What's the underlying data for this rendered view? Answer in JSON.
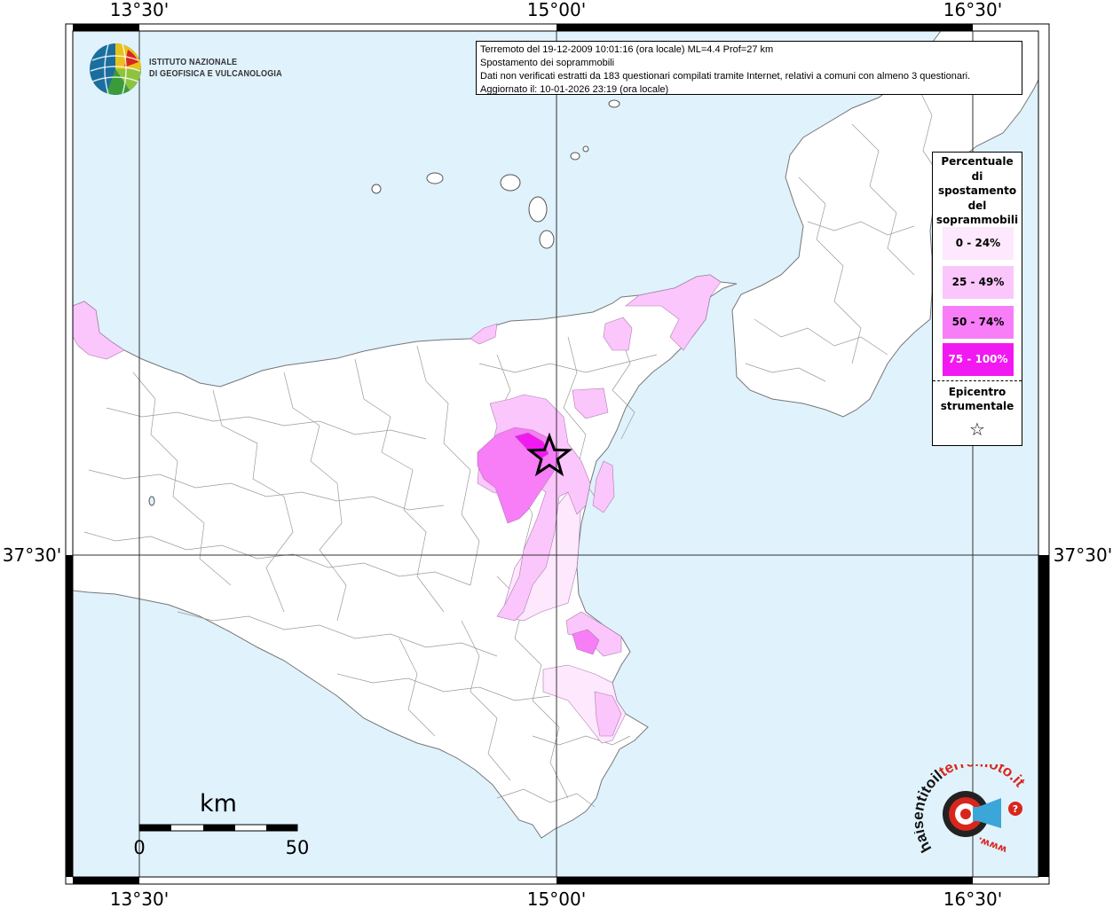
{
  "info": {
    "line1": "Terremoto del 19-12-2009 10:01:16 (ora locale) ML=4.4 Prof=27 km",
    "line2": "Spostamento dei soprammobili",
    "line3": "Dati non verificati estratti da 183 questionari compilati tramite Internet, relativi a comuni con almeno 3 questionari.",
    "line4": "Aggiornato il: 10-01-2026 23:19 (ora locale)"
  },
  "logo": {
    "line1": "ISTITUTO NAZIONALE",
    "line2": "DI GEOFISICA E VULCANOLOGIA"
  },
  "coords": {
    "top_left": "13°30'",
    "top_mid": "15°00'",
    "top_right": "16°30'",
    "bottom_left": "13°30'",
    "bottom_mid": "15°00'",
    "bottom_right": "16°30'",
    "left_lat": "37°30'",
    "right_lat": "37°30'"
  },
  "legend": {
    "title": [
      "Percentuale",
      "di",
      "spostamento",
      "del",
      "soprammobili"
    ],
    "classes": [
      {
        "label": "0 - 24%",
        "color": "#fde8fd",
        "text_color": "#000000"
      },
      {
        "label": "25 - 49%",
        "color": "#fbc6fb",
        "text_color": "#000000"
      },
      {
        "label": "50 - 74%",
        "color": "#f77ef7",
        "text_color": "#000000"
      },
      {
        "label": "75 - 100%",
        "color": "#f218f2",
        "text_color": "#ffffff"
      }
    ],
    "epicenter_label": [
      "Epicentro",
      "strumentale"
    ],
    "epicenter_symbol": "☆"
  },
  "scalebar": {
    "unit": "km",
    "start": "0",
    "end": "50"
  },
  "hsit_logo": {
    "text": "haisentitoilterremoto.it",
    "text_main": "haisentitoil",
    "text_accent": "terremoto.it",
    "url": "www.",
    "icon": "megaphone-target-icon"
  },
  "colors": {
    "sea": "#e0f2fc",
    "land": "#ffffff",
    "border": "#555555"
  }
}
